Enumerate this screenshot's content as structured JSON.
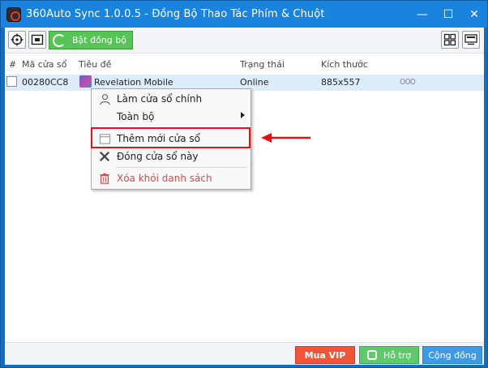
{
  "window": {
    "title": "360Auto Sync 1.0.0.5 - Đồng Bộ Thao Tác Phím & Chuột",
    "minimize_glyph": "—",
    "maximize_glyph": "☐",
    "close_glyph": "✕"
  },
  "toolbar": {
    "sync_label": "Bật đồng bộ",
    "icons": [
      "crosshair-target-icon",
      "window-capture-icon",
      "sync-refresh-icon",
      "grid-layout-icon",
      "monitor-layout-icon"
    ]
  },
  "table": {
    "headers": {
      "index": "#",
      "window_code": "Mã cửa sổ",
      "title": "Tiêu đề",
      "status": "Trạng thái",
      "size": "Kích thước"
    },
    "rows": [
      {
        "window_code": "00280CC8",
        "title": "Revelation Mobile",
        "status": "Online",
        "size": "885x557",
        "more": "ooo"
      }
    ]
  },
  "context_menu": {
    "items": [
      {
        "label": "Làm cửa sổ chính",
        "icon": "person-icon"
      },
      {
        "label": "Toàn bộ",
        "icon": "",
        "has_submenu": true
      },
      {
        "label": "Thêm mới cửa sổ",
        "icon": "window-icon",
        "highlighted": true
      },
      {
        "label": "Đóng cửa sổ này",
        "icon": "close-x-icon"
      },
      {
        "label": "Xóa khỏi danh sách",
        "icon": "trash-icon",
        "danger": true
      }
    ]
  },
  "footer": {
    "vip_label": "Mua VIP",
    "support_label": "Hỗ trợ",
    "sync_all_label": "Cộng đồng"
  },
  "colors": {
    "titlebar": "#1a83dd",
    "accent_green": "#56c456",
    "vip_red": "#f0553a",
    "selected_row": "#dcecfb",
    "highlight_red": "#e0141a"
  }
}
